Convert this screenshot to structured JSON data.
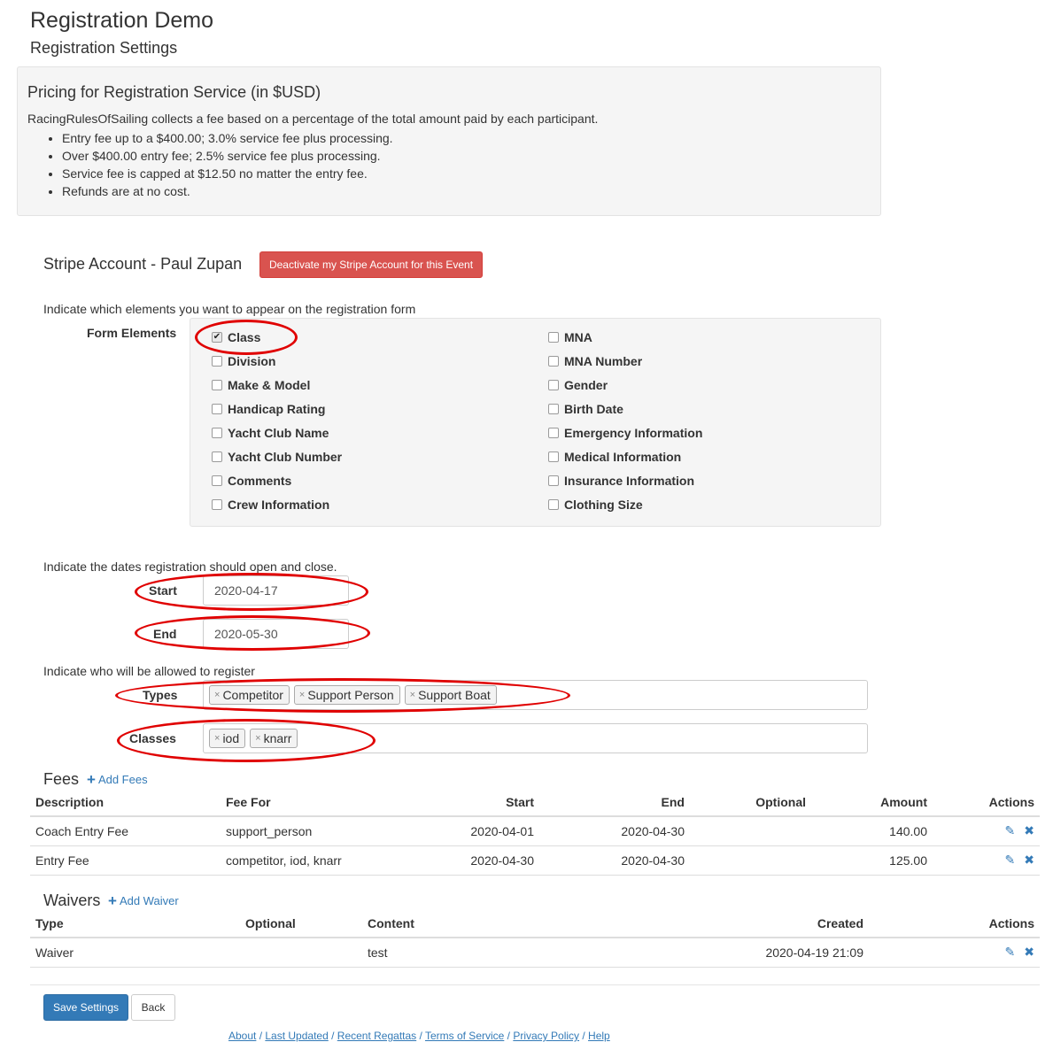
{
  "page": {
    "title": "Registration Demo",
    "subtitle": "Registration Settings"
  },
  "pricing": {
    "title": "Pricing for Registration Service (in $USD)",
    "intro": "RacingRulesOfSailing collects a fee based on a percentage of the total amount paid by each participant.",
    "bullets": [
      "Entry fee up to a $400.00; 3.0% service fee plus processing.",
      "Over $400.00 entry fee; 2.5% service fee plus processing.",
      "Service fee is capped at $12.50 no matter the entry fee.",
      "Refunds are at no cost."
    ]
  },
  "stripe": {
    "label": "Stripe Account - Paul Zupan",
    "deactivate_label": "Deactivate my Stripe Account for this Event"
  },
  "form_elements": {
    "instruction": "Indicate which elements you want to appear on the registration form",
    "label": "Form Elements",
    "left": [
      {
        "label": "Class",
        "checked": true
      },
      {
        "label": "Division",
        "checked": false
      },
      {
        "label": "Make & Model",
        "checked": false
      },
      {
        "label": "Handicap Rating",
        "checked": false
      },
      {
        "label": "Yacht Club Name",
        "checked": false
      },
      {
        "label": "Yacht Club Number",
        "checked": false
      },
      {
        "label": "Comments",
        "checked": false
      },
      {
        "label": "Crew Information",
        "checked": false
      }
    ],
    "right": [
      {
        "label": "MNA",
        "checked": false
      },
      {
        "label": "MNA Number",
        "checked": false
      },
      {
        "label": "Gender",
        "checked": false
      },
      {
        "label": "Birth Date",
        "checked": false
      },
      {
        "label": "Emergency Information",
        "checked": false
      },
      {
        "label": "Medical Information",
        "checked": false
      },
      {
        "label": "Insurance Information",
        "checked": false
      },
      {
        "label": "Clothing Size",
        "checked": false
      }
    ]
  },
  "dates": {
    "instruction": "Indicate the dates registration should open and close.",
    "start_label": "Start",
    "start_value": "2020-04-17",
    "end_label": "End",
    "end_value": "2020-05-30"
  },
  "allowed": {
    "instruction": "Indicate who will be allowed to register",
    "types_label": "Types",
    "types": [
      "Competitor",
      "Support Person",
      "Support Boat"
    ],
    "classes_label": "Classes",
    "classes": [
      "iod",
      "knarr"
    ],
    "remove_glyph": "×"
  },
  "fees": {
    "title": "Fees",
    "add_label": "Add Fees",
    "columns": [
      "Description",
      "Fee For",
      "Start",
      "End",
      "Optional",
      "Amount",
      "Actions"
    ],
    "rows": [
      {
        "description": "Coach Entry Fee",
        "fee_for": "support_person",
        "start": "2020-04-01",
        "end": "2020-04-30",
        "optional": "",
        "amount": "140.00"
      },
      {
        "description": "Entry Fee",
        "fee_for": "competitor, iod, knarr",
        "start": "2020-04-30",
        "end": "2020-04-30",
        "optional": "",
        "amount": "125.00"
      }
    ]
  },
  "waivers": {
    "title": "Waivers",
    "add_label": "Add Waiver",
    "columns": [
      "Type",
      "Optional",
      "Content",
      "Created",
      "Actions"
    ],
    "rows": [
      {
        "type": "Waiver",
        "optional": "",
        "content": "test",
        "created": "2020-04-19 21:09"
      }
    ]
  },
  "actions": {
    "save_label": "Save Settings",
    "back_label": "Back"
  },
  "footer": {
    "links": [
      "About",
      "Last Updated",
      "Recent Regattas",
      "Terms of Service",
      "Privacy Policy",
      "Help"
    ],
    "separator": " / "
  },
  "icons": {
    "plus": "plus-icon",
    "edit": "pencil-icon",
    "delete": "remove-icon",
    "checkmark": "checkmark-icon"
  },
  "colors": {
    "primary": "#337ab7",
    "danger": "#d9534f",
    "annotation": "#e00000"
  }
}
